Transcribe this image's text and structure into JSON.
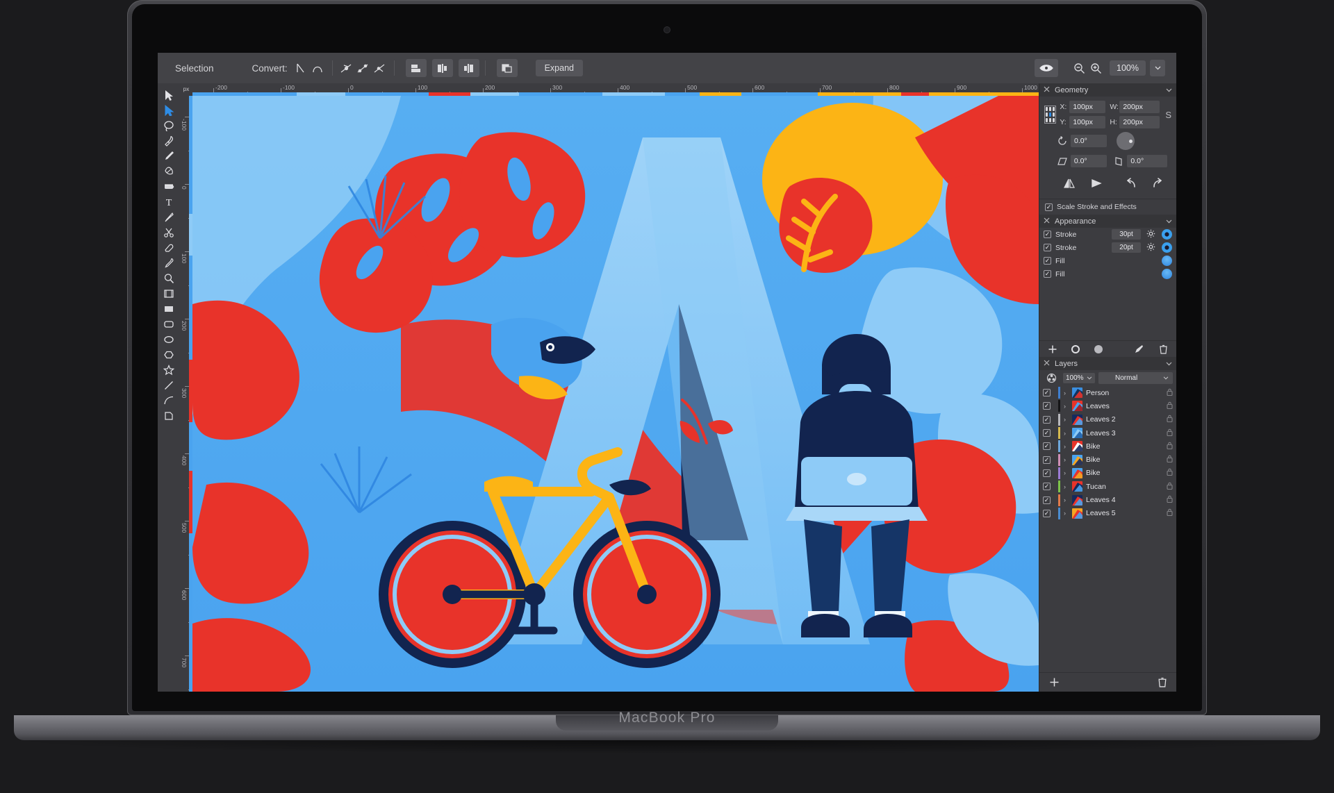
{
  "device": {
    "label": "MacBook Pro"
  },
  "toolbar": {
    "selection_label": "Selection",
    "convert_label": "Convert:",
    "expand_label": "Expand",
    "zoom_level": "100%",
    "icons": {
      "convert_to_line": "convert-to-line-icon",
      "convert_to_curve": "convert-to-curve-icon",
      "sharp_node": "sharp-node-icon",
      "smooth_node": "smooth-node-icon",
      "smart_node": "smart-node-icon",
      "break_curve": "break-curve-icon",
      "close_curve": "close-curve-icon",
      "smooth_curve": "smooth-curve-icon",
      "reverse_curve": "reverse-curve-icon",
      "geometry_boolean": "boolean-geometry-icon",
      "preview": "eye-preview-icon",
      "zoom_out": "zoom-out-icon",
      "zoom_in": "zoom-in-icon",
      "zoom_dropdown": "chevron-down-icon"
    }
  },
  "tools": [
    {
      "name": "move-tool",
      "icon": "cursor-arrow-icon"
    },
    {
      "name": "node-tool",
      "icon": "node-arrow-icon",
      "active": true
    },
    {
      "name": "lasso-tool",
      "icon": "lasso-icon"
    },
    {
      "name": "pen-tool",
      "icon": "pen-icon"
    },
    {
      "name": "pencil-tool",
      "icon": "pencil-icon"
    },
    {
      "name": "node-edit-tool",
      "icon": "vector-brush-icon"
    },
    {
      "name": "fill-tool",
      "icon": "fill-gradient-icon"
    },
    {
      "name": "text-tool",
      "icon": "text-t-icon"
    },
    {
      "name": "knife-tool",
      "icon": "knife-icon"
    },
    {
      "name": "scissors-tool",
      "icon": "scissors-icon"
    },
    {
      "name": "eraser-tool",
      "icon": "eraser-icon"
    },
    {
      "name": "color-picker-tool",
      "icon": "eyedropper-icon"
    },
    {
      "name": "zoom-tool",
      "icon": "magnifier-icon"
    },
    {
      "name": "transform-tool",
      "icon": "perspective-icon"
    },
    {
      "name": "rectangle-tool",
      "icon": "rectangle-icon"
    },
    {
      "name": "rounded-rectangle-tool",
      "icon": "rounded-rectangle-icon"
    },
    {
      "name": "ellipse-tool",
      "icon": "ellipse-icon"
    },
    {
      "name": "polygon-tool",
      "icon": "polygon-icon"
    },
    {
      "name": "star-tool",
      "icon": "star-icon"
    },
    {
      "name": "line-tool",
      "icon": "line-icon"
    },
    {
      "name": "curve-tool",
      "icon": "curve-icon"
    },
    {
      "name": "corner-tool",
      "icon": "corner-shape-icon"
    }
  ],
  "rulers": {
    "unit": "px",
    "horizontal_ticks": [
      "-200",
      "-100",
      "0",
      "100",
      "200",
      "300",
      "400",
      "500",
      "600",
      "700",
      "800",
      "900",
      "1000"
    ],
    "vertical_ticks": [
      "-100",
      "0",
      "100",
      "200",
      "300",
      "400",
      "500",
      "600",
      "700"
    ]
  },
  "geometry": {
    "title": "Geometry",
    "x_label": "X:",
    "x_value": "100px",
    "y_label": "Y:",
    "y_value": "100px",
    "w_label": "W:",
    "w_value": "200px",
    "h_label": "H:",
    "h_value": "200px",
    "lock_ratio": "S",
    "rotation": "0.0°",
    "shear_x": "0.0°",
    "shear_y": "0.0°",
    "scale_stroke_label": "Scale Stroke and Effects",
    "scale_stroke_checked": "✓",
    "icons": {
      "rotation": "rotate-ccw-icon",
      "shear_x": "shear-horizontal-icon",
      "shear_y": "shear-vertical-icon",
      "flip_h": "flip-horizontal-icon",
      "flip_v": "flip-vertical-icon",
      "rotate_left": "rotate-left-icon",
      "rotate_right": "rotate-right-icon"
    }
  },
  "appearance": {
    "title": "Appearance",
    "check": "✓",
    "rows": [
      {
        "name": "Stroke",
        "value": "30pt",
        "type": "stroke",
        "has_gear": true
      },
      {
        "name": "Stroke",
        "value": "20pt",
        "type": "stroke",
        "has_gear": true
      },
      {
        "name": "Fill",
        "value": "",
        "type": "fill",
        "has_gear": false
      },
      {
        "name": "Fill",
        "value": "",
        "type": "fill",
        "has_gear": false
      }
    ],
    "footer_icons": [
      "add-icon",
      "stroke-circle-icon",
      "fill-circle-icon",
      "brush-icon",
      "trash-icon"
    ]
  },
  "layers": {
    "title": "Layers",
    "opacity": "100%",
    "blend_mode": "Normal",
    "check": "✓",
    "items": [
      {
        "label": "Person",
        "bar": "#3f7fd0",
        "thumb": [
          "#3b8fe0",
          "#12325e",
          "#e8332a"
        ]
      },
      {
        "label": "Leaves",
        "bar": "#151517",
        "thumb": [
          "#e8332a",
          "#4aa3ef",
          "#a9181a"
        ]
      },
      {
        "label": "Leaves 2",
        "bar": "#b8b8bd",
        "thumb": [
          "#152a5e",
          "#e8332a",
          "#4aa3ef"
        ]
      },
      {
        "label": "Leaves 3",
        "bar": "#d5b94f",
        "thumb": [
          "#4aa3ef",
          "#8ecbf7",
          "#1d5fa8"
        ]
      },
      {
        "label": "Bike",
        "bar": "#6fa8dc",
        "thumb": [
          "#e8332a",
          "#ffffff",
          "#16295c"
        ]
      },
      {
        "label": "Bike",
        "bar": "#cf8fb5",
        "thumb": [
          "#4aa3ef",
          "#f5a623",
          "#16295c"
        ]
      },
      {
        "label": "Bike",
        "bar": "#9b7bd4",
        "thumb": [
          "#4aa3ef",
          "#e8332a",
          "#f5a623"
        ]
      },
      {
        "label": "Tucan",
        "bar": "#7dc24a",
        "thumb": [
          "#e8332a",
          "#16295c",
          "#4aa3ef"
        ]
      },
      {
        "label": "Leaves 4",
        "bar": "#e07a4a",
        "thumb": [
          "#16295c",
          "#e8332a",
          "#4aa3ef"
        ]
      },
      {
        "label": "Leaves 5",
        "bar": "#4a8cd0",
        "thumb": [
          "#f5a623",
          "#e8332a",
          "#4aa3ef"
        ]
      }
    ],
    "footer_icons": [
      "add-layer-icon",
      "delete-layer-icon"
    ]
  },
  "colors": {
    "accent": "#2e8de6",
    "panel_bg": "#3c3c40",
    "toolbar_bg": "#434347",
    "field_bg": "#4e4e52",
    "art_blue": "#4aa3ef",
    "art_light_blue": "#8ecbf7",
    "art_red": "#e8332a",
    "art_navy": "#12244f",
    "art_yellow": "#fcb415",
    "art_orange": "#f68b1f"
  }
}
